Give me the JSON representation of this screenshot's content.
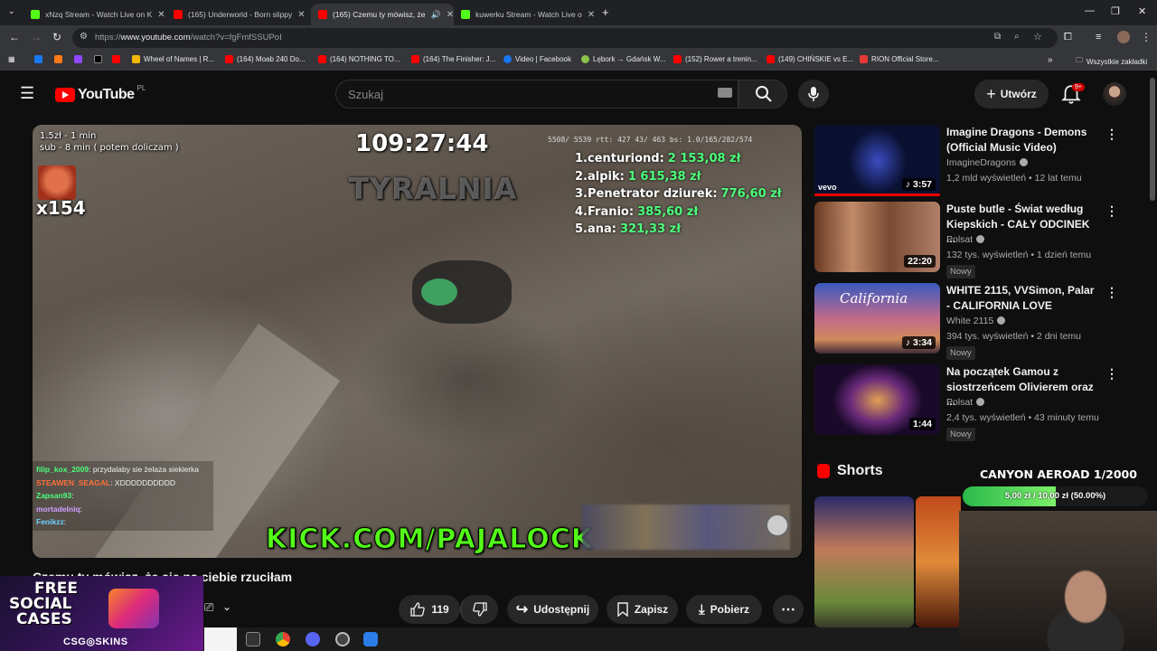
{
  "browser": {
    "tabs": [
      {
        "label": "xNzq Stream - Watch Live on K",
        "color": "#53fc18"
      },
      {
        "label": "(165) Underworld - Born slippy",
        "color": "#ff0000"
      },
      {
        "label": "(165) Czemu ty mówisz, że",
        "color": "#ff0000"
      },
      {
        "label": "kuwerku Stream - Watch Live o",
        "color": "#53fc18"
      }
    ],
    "url_prefix": "https://",
    "url_host": "www.youtube.com",
    "url_path": "/watch?v=fgFmfSSUPoI",
    "bookmarks": [
      "Wheel of Names | R...",
      "(164) Moab 240 Do...",
      "(164) NOTHING TO...",
      "(164) The Finisher: J...",
      "Video | Facebook",
      "Lębork → Gdańsk W...",
      "(152) Rower a trenin...",
      "(149) CHIŃSKIE vs E...",
      "RION Official Store..."
    ],
    "all_bookmarks": "Wszystkie zakładki"
  },
  "header": {
    "logo_text": "YouTube",
    "country": "PL",
    "search_placeholder": "Szukaj",
    "create_label": "Utwórz",
    "notif_count": "9+"
  },
  "player": {
    "donor_info_1": "1.5zł - 1 min",
    "donor_info_2": "sub - 8 min ( potem doliczam )",
    "timer": "109:27:44",
    "multiplier": "x154",
    "watermark": "TYRALNIA",
    "stats": "5508/ 5539 rtt: 427 43/ 463 bs: 1.0/165/282/574",
    "leaderboard": [
      {
        "rank": "1.",
        "name": "centuriond:",
        "amount": "2 153,08 zł"
      },
      {
        "rank": "2.",
        "name": "alpik:",
        "amount": "1 615,38 zł"
      },
      {
        "rank": "3.",
        "name": "Penetrator dziurek:",
        "amount": "776,60 zł"
      },
      {
        "rank": "4.",
        "name": "Franio:",
        "amount": "385,60 zł"
      },
      {
        "rank": "5.",
        "name": "ana:",
        "amount": "321,33 zł"
      }
    ],
    "kick_url": "KICK.COM/PAJALOCK",
    "chat": [
      {
        "user": "filip_kox_2009",
        "text": ": przydalaby sie żelaza siekierka",
        "color": "#4cff7a"
      },
      {
        "user": "STEAWEN_SEAGAL",
        "text": ": XDDDDDDDDDD",
        "color": "#ff6f3c"
      },
      {
        "user": "Zapsan93",
        "text": ":",
        "color": "#4cff7a"
      },
      {
        "user": "mortadelniq",
        "text": ":",
        "color": "#cfa0ff"
      },
      {
        "user": "Fenikzz",
        "text": ":",
        "color": "#6fd0ff"
      }
    ]
  },
  "video": {
    "title": "Czemu ty mówisz, że się na ciebie rzuciłam",
    "likes": "119",
    "share_label": "Udostępnij",
    "save_label": "Zapisz",
    "download_label": "Pobierz"
  },
  "ad": {
    "line1": "FREE",
    "line2": "SOCIAL",
    "line3": "CASES",
    "brand": "CSG◎SKINS"
  },
  "sidebar": {
    "recs": [
      {
        "title": "Imagine Dragons - Demons (Official Music Video)",
        "channel": "ImagineDragons",
        "meta": "1,2 mld wyświetleń • 12 lat temu",
        "duration": "3:57",
        "badge": "",
        "thumb": "#1a2a6a"
      },
      {
        "title": "Puste butle - Świat według Kiepskich - CAŁY ODCINEK ...",
        "channel": "Polsat",
        "meta": "132 tys. wyświetleń • 1 dzień temu",
        "duration": "22:20",
        "badge": "Nowy",
        "thumb": "#8a4a2a"
      },
      {
        "title": "WHITE 2115, VVSimon, Palar - CALIFORNIA LOVE",
        "channel": "White 2115",
        "meta": "394 tys. wyświetleń • 2 dni temu",
        "duration": "3:34",
        "badge": "Nowy",
        "thumb": "#3a4a8a"
      },
      {
        "title": "Na początek Gamou z siostrzeńcem Olivierem oraz ...",
        "channel": "Polsat",
        "meta": "2,4 tys. wyświetleń • 43 minuty temu",
        "duration": "1:44",
        "badge": "Nowy",
        "thumb": "#5a2a6a"
      }
    ],
    "shorts_label": "Shorts"
  },
  "stream_overlay": {
    "goal_title": "CANYON AEROAD 1/2000",
    "goal_text": "5,00 zł / 10,00 zł (50.00%)",
    "goal_fraction": 0.5
  }
}
